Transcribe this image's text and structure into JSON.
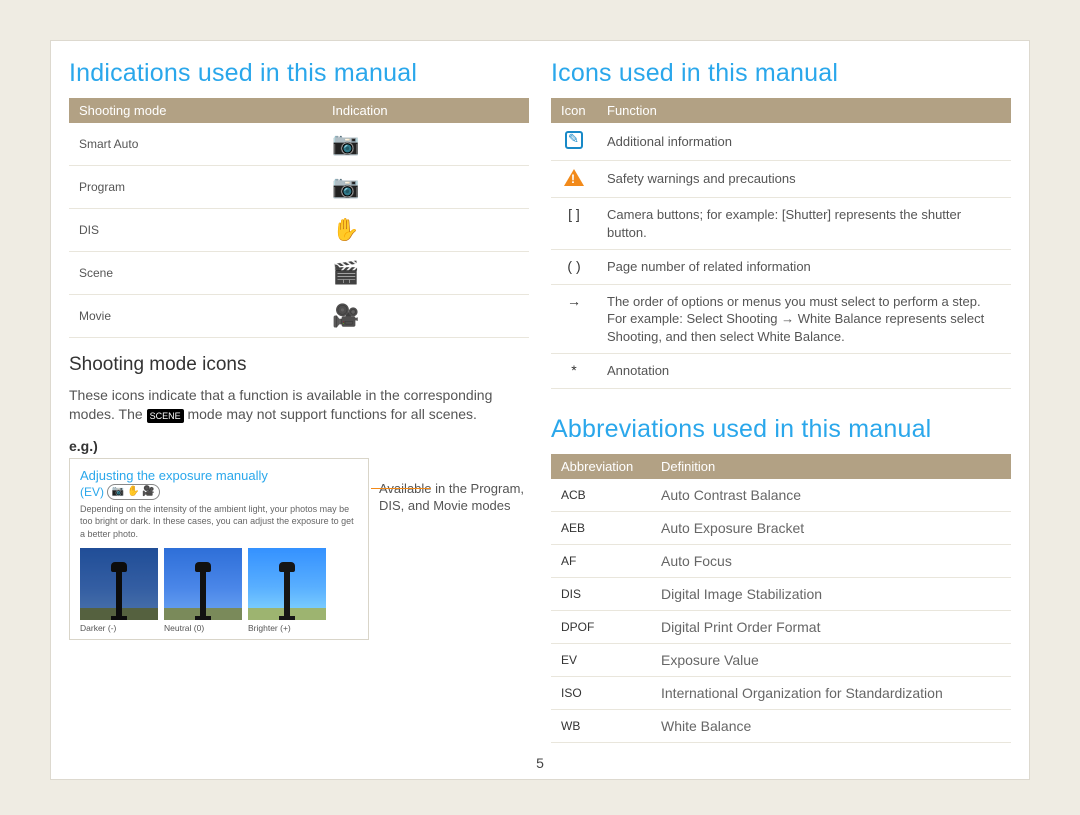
{
  "page_number": "5",
  "left": {
    "title": "Indications used in this manual",
    "table_headers": [
      "Shooting mode",
      "Indication"
    ],
    "modes": [
      {
        "label": "Smart Auto",
        "icon": "camera-smart-icon",
        "glyph": "📷"
      },
      {
        "label": "Program",
        "icon": "camera-p-icon",
        "glyph": "📷"
      },
      {
        "label": "DIS",
        "icon": "hand-wave-icon",
        "glyph": "✋"
      },
      {
        "label": "Scene",
        "icon": "film-scene-icon",
        "glyph": "🎬"
      },
      {
        "label": "Movie",
        "icon": "movie-camera-icon",
        "glyph": "🎥"
      }
    ],
    "sub_title": "Shooting mode icons",
    "sub_para_a": "These icons indicate that a function is available in the corresponding modes. The ",
    "sub_para_b": " mode may not support functions for all scenes.",
    "eg_label": "e.g.)",
    "example": {
      "title": "Adjusting the exposure manually",
      "ev": "(EV)",
      "icons_glyph": "📷 ✋ 🎥",
      "desc": "Depending on the intensity of the ambient light, your photos may be too bright or dark. In these cases, you can adjust the exposure to get a better photo.",
      "captions": [
        "Darker (-)",
        "Neutral (0)",
        "Brighter (+)"
      ]
    },
    "leader_text": "Available in the Program, DIS, and Movie modes"
  },
  "right": {
    "icons_title": "Icons used in this manual",
    "icons_headers": [
      "Icon",
      "Function"
    ],
    "icons": [
      {
        "type": "info",
        "desc": "Additional information"
      },
      {
        "type": "warn",
        "desc": "Safety warnings and precautions"
      },
      {
        "type": "bracket",
        "glyph": "[ ]",
        "desc_a": "Camera buttons; for example: [",
        "desc_bold": "Shutter",
        "desc_b": "] represents the shutter button."
      },
      {
        "type": "paren",
        "glyph": "( )",
        "desc": "Page number of related information"
      },
      {
        "type": "arrow",
        "glyph": "→",
        "desc_a": "The order of options or menus you must select to perform a step. For example: Select ",
        "desc_bold1": "Shooting",
        "desc_arrow": " → ",
        "desc_bold2": "White Balance",
        "desc_b": " represents select ",
        "desc_bold3": "Shooting",
        "desc_c": ", and then select ",
        "desc_bold4": "White Balance",
        "desc_d": "."
      },
      {
        "type": "star",
        "glyph": "*",
        "desc": "Annotation"
      }
    ],
    "abbrev_title": "Abbreviations used in this manual",
    "abbrev_headers": [
      "Abbreviation",
      "Definition"
    ],
    "abbrev": [
      {
        "k": "ACB",
        "v": "Auto Contrast Balance"
      },
      {
        "k": "AEB",
        "v": "Auto Exposure Bracket"
      },
      {
        "k": "AF",
        "v": "Auto Focus"
      },
      {
        "k": "DIS",
        "v": "Digital Image Stabilization"
      },
      {
        "k": "DPOF",
        "v": "Digital Print Order Format"
      },
      {
        "k": "EV",
        "v": "Exposure Value"
      },
      {
        "k": "ISO",
        "v": "International Organization for Standardization"
      },
      {
        "k": "WB",
        "v": "White Balance"
      }
    ]
  }
}
